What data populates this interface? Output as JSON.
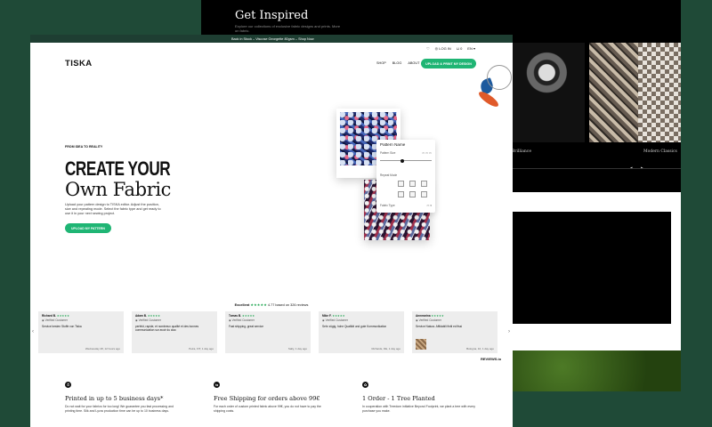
{
  "back": {
    "title": "Get Inspired",
    "subtitle": "Explore our collections of exclusive fabric designs and prints. More on fabric.",
    "captions": [
      "Brilliance",
      "Modern Classics"
    ]
  },
  "announcement": "Back in Stock – Viscose Georgette 80gsm – Shop Now",
  "topbar": {
    "login": "LOG IN",
    "cart": "0",
    "lang": "EN"
  },
  "nav": {
    "logo": "TISKA",
    "menu": [
      "SHOP",
      "BLOG",
      "ABOUT"
    ],
    "cta": "UPLOAD & PRINT MY DESIGN"
  },
  "hero": {
    "kicker": "FROM IDEA TO REALITY",
    "title_line1": "CREATE YOUR",
    "title_line2": "Own Fabric",
    "description": "Upload your pattern design to TISKA editor. Adjust the position, size and repeating mode. Select the fabric type and get ready to use it in your next sewing project.",
    "cta": "UPLOAD MY PATTERN"
  },
  "editor": {
    "title": "Pattern Name",
    "pattern_size_label": "Pattern Size",
    "repeat_mode_label": "Repeat Mode",
    "fabric_type_label": "Fabric Type"
  },
  "rating": {
    "label": "Excellent",
    "stars": "★★★★★",
    "score_text": "4.77 based on 326 reviews"
  },
  "reviews": [
    {
      "name": "Richard B.",
      "stars": "★★★★★",
      "verified": "Verified Customer",
      "text": "Service besten Stoffe von Tiska",
      "date": "Wednesday 28, 12 hours ago"
    },
    {
      "name": "Adam B.",
      "stars": "★★★★★",
      "verified": "Verified Customer",
      "text": "perfekt, rapide, et nombreux qualité et des bonnes communication sur avoir du ciao",
      "date": "Petra, FIT, 1 day ago"
    },
    {
      "name": "Tomas B.",
      "stars": "★★★★★",
      "verified": "Verified Customer",
      "text": "Fast shipping, great service",
      "date": "Sally, 1 day ago"
    },
    {
      "name": "Mike F.",
      "stars": "★★★★★",
      "verified": "Verified Customer",
      "text": "Sehr zügig, hohe Qualität und gute Kommunikation",
      "date": "Richards, DE, 1 day ago"
    },
    {
      "name": "Annmarina",
      "stars": "★★★★★",
      "verified": "Verified Customer",
      "text": "Service Natura. Affidabili finiti ed fissi",
      "date": "Bologna, 10, 1 day ago"
    }
  ],
  "reviews_brand": "REVIEWS.io",
  "features": [
    {
      "icon": "⏱",
      "title": "Printed in up to 5 business days*",
      "desc": "Do not wait for your fabrics for too long! We guarantee you fast processing and printing time. Silk and Lycra production time can be up to 10 business days."
    },
    {
      "icon": "⇆",
      "title": "Free Shipping for orders above 99€",
      "desc": "For each order of custom printed fabric above 99€, you do not have to pay the shipping costs."
    },
    {
      "icon": "✿",
      "title": "1 Order - 1 Tree Planted",
      "desc": "In cooperation with Treedom initiative Beyond Footprint, we plant a tree with every purchase you make."
    }
  ],
  "colors": {
    "background": "#1f4a37",
    "accent": "#1fb574",
    "announcement_bg": "#1e3e32",
    "star": "#16a34a"
  }
}
